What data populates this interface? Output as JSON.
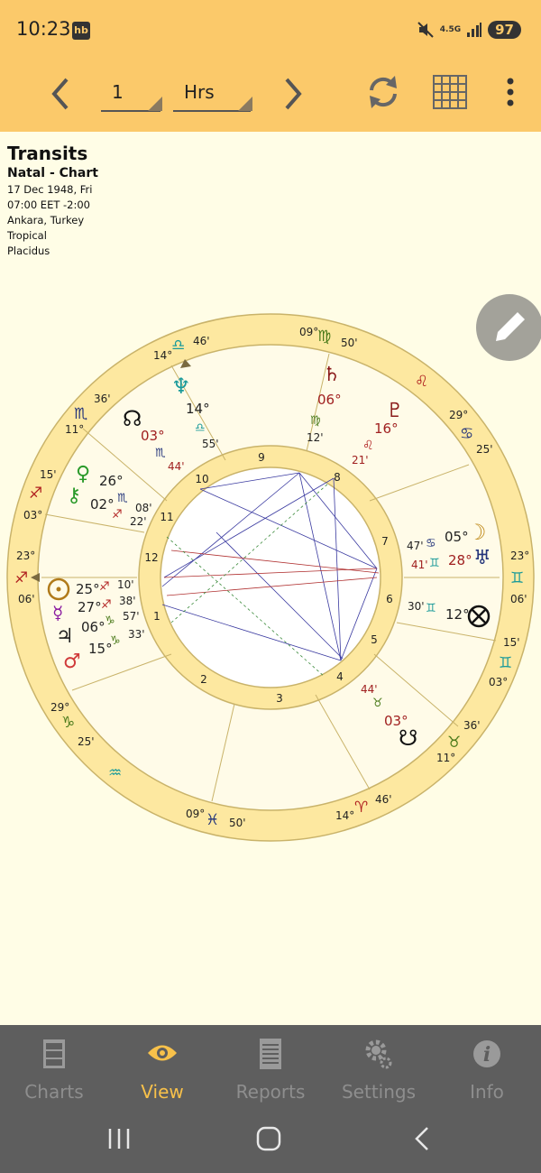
{
  "status_bar": {
    "time": "10:23",
    "app_badge": "hb",
    "network": "4.5G",
    "battery": "97"
  },
  "toolbar": {
    "step_value": "1",
    "unit_value": "Hrs"
  },
  "header": {
    "title": "Transits",
    "subtitle": "Natal - Chart",
    "lines": [
      "17 Dec 1948, Fri",
      "07:00 EET -2:00",
      "Ankara, Turkey",
      "Tropical",
      "Placidus"
    ]
  },
  "chart": {
    "house_numbers": [
      "1",
      "2",
      "3",
      "4",
      "5",
      "6",
      "7",
      "8",
      "9",
      "10",
      "11",
      "12"
    ],
    "cusp_labels": [
      {
        "deg": "09°",
        "min": "50'"
      },
      {
        "deg": "14°",
        "min": "46'"
      },
      {
        "deg": "11°",
        "min": "36'"
      },
      {
        "deg": "03°",
        "min": "15'"
      },
      {
        "deg": "23°",
        "min": "06'"
      },
      {
        "deg": "29°",
        "min": "25'"
      },
      {
        "deg": "09°",
        "min": "50'"
      },
      {
        "deg": "14°",
        "min": "46'"
      },
      {
        "deg": "11°",
        "min": "36'"
      },
      {
        "deg": "03°",
        "min": "15'"
      },
      {
        "deg": "23°",
        "min": "06'"
      },
      {
        "deg": "29°",
        "min": "25'"
      }
    ],
    "planets": [
      {
        "deg": "06°",
        "min": "12'"
      },
      {
        "deg": "16°",
        "min": "21'"
      },
      {
        "deg": "05°",
        "min": "47'"
      },
      {
        "deg": "28°",
        "min": "41'"
      },
      {
        "deg": "12°",
        "min": "30'"
      },
      {
        "deg": "03°",
        "min": "44'"
      },
      {
        "deg": "03°",
        "min": "44'"
      },
      {
        "deg": "14°",
        "min": "55'"
      },
      {
        "deg": "26°",
        "min": "08'"
      },
      {
        "deg": "02°",
        "min": "22'"
      },
      {
        "deg": "25°",
        "min": "10'"
      },
      {
        "deg": "27°",
        "min": "38'"
      },
      {
        "deg": "06°",
        "min": "57'"
      },
      {
        "deg": "15°",
        "min": "33'"
      }
    ]
  },
  "nav": [
    {
      "label": "Charts",
      "icon": "cabinet-icon"
    },
    {
      "label": "View",
      "icon": "eye-icon"
    },
    {
      "label": "Reports",
      "icon": "report-icon"
    },
    {
      "label": "Settings",
      "icon": "gear-icon"
    },
    {
      "label": "Info",
      "icon": "info-icon"
    }
  ],
  "colors": {
    "accent": "#fbc96a",
    "active_nav": "#f8c14a",
    "background": "#fffde6",
    "wheel_ring": "#fde8a0"
  }
}
